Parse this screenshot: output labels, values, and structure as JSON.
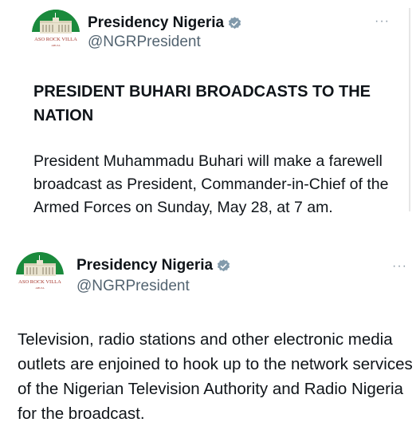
{
  "tweets": [
    {
      "display_name": "Presidency Nigeria",
      "handle": "@NGRPresident",
      "avatar_text": "ASO ROCK VILLA",
      "avatar_subtext": "ABUJA",
      "verified_icon": "verified-badge-icon",
      "more_label": "···",
      "headline": "PRESIDENT BUHARI BROADCASTS TO THE NATION",
      "body": "President Muhammadu Buhari will make a farewell broadcast as President, Commander-in-Chief of the Armed Forces on Sunday, May 28, at 7 am."
    },
    {
      "display_name": "Presidency Nigeria",
      "handle": "@NGRPresident",
      "avatar_text": "ASO ROCK VILLA",
      "avatar_subtext": "ABUJA",
      "verified_icon": "verified-badge-icon",
      "more_label": "···",
      "body": "Television, radio stations and other electronic media outlets are enjoined to hook up to the network services of the Nigerian Television Authority and Radio Nigeria for the broadcast."
    }
  ],
  "colors": {
    "text": "#0f1419",
    "handle": "#536471",
    "verified": "#829aab",
    "avatar_green": "#1a7f37"
  }
}
